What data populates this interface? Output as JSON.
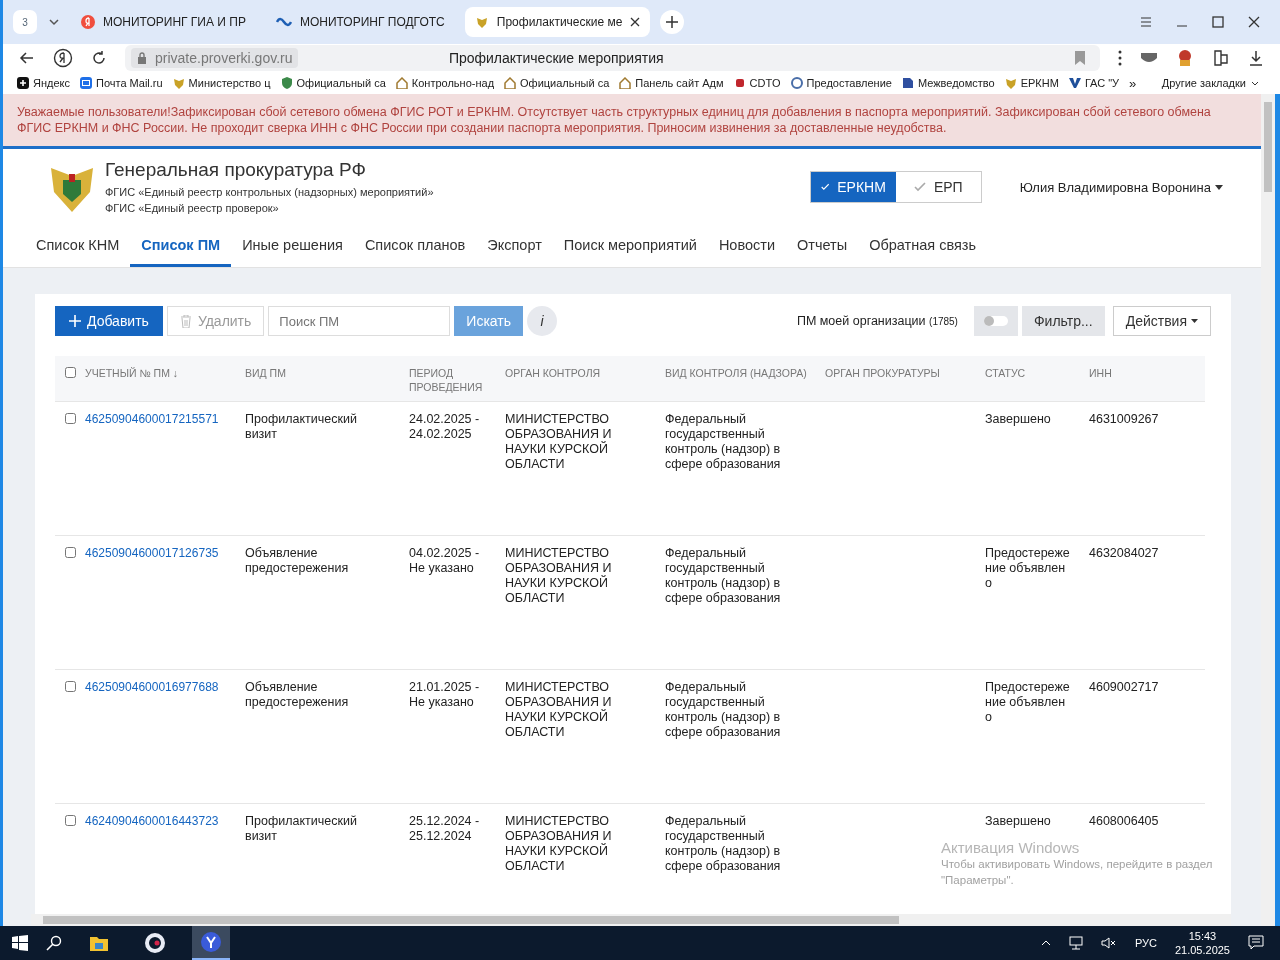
{
  "browser": {
    "tab_count": "3",
    "tabs": [
      {
        "title": "МОНИТОРИНГ ГИА И ПР",
        "selected": false,
        "kind": "yandex"
      },
      {
        "title": "МОНИТОРИНГ ПОДГОТС",
        "selected": false,
        "kind": "wave"
      },
      {
        "title": "Профилактические ме",
        "selected": true,
        "kind": "emblem"
      }
    ],
    "url": "private.proverki.gov.ru",
    "page_title": "Профилактические мероприятия",
    "bookmarks": [
      {
        "label": "Яндекс",
        "kind": "plus"
      },
      {
        "label": "Почта Mail.ru",
        "kind": "mail"
      },
      {
        "label": "Министерство ц",
        "kind": "emblem"
      },
      {
        "label": "Официальный са",
        "kind": "shield"
      },
      {
        "label": "Контрольно-над",
        "kind": "house"
      },
      {
        "label": "Официальный са",
        "kind": "house"
      },
      {
        "label": "Панель сайт Адм",
        "kind": "house"
      },
      {
        "label": "CDTO",
        "kind": "red"
      },
      {
        "label": "Предоставление",
        "kind": "circle"
      },
      {
        "label": "Межведомство",
        "kind": "book"
      },
      {
        "label": "ЕРКНМ",
        "kind": "emblem"
      },
      {
        "label": "ГАС \"У",
        "kind": "v"
      }
    ],
    "more_bookmarks": "»",
    "other_bookmarks": "Другие закладки"
  },
  "banner": "Уважаемые пользователи!Зафиксирован сбой сетевого обмена ФГИС РОТ и ЕРКНМ. Отсутствует часть структурных единиц для добавления в паспорта мероприятий. Зафиксирован сбой сетевого обмена ФГИС ЕРКНМ и ФНС России. Не проходит сверка ИНН с ФНС России при создании паспорта мероприятия. Приносим извинения за доставленные неудобства.",
  "header": {
    "title": "Генеральная прокуратура РФ",
    "subtitles": [
      "ФГИС «Единый реестр контрольных (надзорных) мероприятий»",
      "ФГИС «Единый реестр проверок»"
    ],
    "systems": [
      {
        "label": "ЕРКНМ",
        "selected": true
      },
      {
        "label": "ЕРП",
        "selected": false
      }
    ],
    "user": "Юлия Владимировна Воронина"
  },
  "nav": [
    {
      "label": "Список КНМ",
      "selected": false
    },
    {
      "label": "Список ПМ",
      "selected": true
    },
    {
      "label": "Иные решения",
      "selected": false
    },
    {
      "label": "Список планов",
      "selected": false
    },
    {
      "label": "Экспорт",
      "selected": false
    },
    {
      "label": "Поиск мероприятий",
      "selected": false
    },
    {
      "label": "Новости",
      "selected": false
    },
    {
      "label": "Отчеты",
      "selected": false
    },
    {
      "label": "Обратная связь",
      "selected": false
    }
  ],
  "toolbar": {
    "add": "Добавить",
    "delete": "Удалить",
    "search_placeholder": "Поиск ПМ",
    "search": "Искать",
    "info": "i",
    "my_org": "ПМ моей организации",
    "my_org_count": "(1785)",
    "my_org_on": false,
    "filter": "Фильтр...",
    "actions": "Действия"
  },
  "table": {
    "all_checked": false,
    "columns": [
      "УЧЕТНЫЙ № ПМ ↓",
      "ВИД ПМ",
      "ПЕРИОД ПРОВЕДЕНИЯ",
      "ОРГАН КОНТРОЛЯ",
      "ВИД КОНТРОЛЯ (НАДЗОРА)",
      "ОРГАН ПРОКУРАТУРЫ",
      "СТАТУС",
      "ИНН"
    ],
    "rows": [
      {
        "checked": false,
        "number": "46250904600017215571",
        "type": "Профилактический визит",
        "period": [
          "24.02.2025 -",
          "24.02.2025"
        ],
        "authority": "МИНИСТЕРСТВО ОБРАЗОВАНИЯ И НАУКИ КУРСКОЙ ОБЛАСТИ",
        "control": "Федеральный государственный контроль (надзор) в сфере образования",
        "status": "Завершено",
        "inn": "4631009267"
      },
      {
        "checked": false,
        "number": "46250904600017126735",
        "type": "Объявление предостережения",
        "period": [
          "04.02.2025 -",
          "Не указано"
        ],
        "authority": "МИНИСТЕРСТВО ОБРАЗОВАНИЯ И НАУКИ КУРСКОЙ ОБЛАСТИ",
        "control": "Федеральный государственный контроль (надзор) в сфере образования",
        "status": "Предостережение объявлено",
        "inn": "4632084027"
      },
      {
        "checked": false,
        "number": "46250904600016977688",
        "type": "Объявление предостережения",
        "period": [
          "21.01.2025 -",
          "Не указано"
        ],
        "authority": "МИНИСТЕРСТВО ОБРАЗОВАНИЯ И НАУКИ КУРСКОЙ ОБЛАСТИ",
        "control": "Федеральный государственный контроль (надзор) в сфере образования",
        "status": "Предостережение объявлено",
        "inn": "4609002717"
      },
      {
        "checked": false,
        "number": "46240904600016443723",
        "type": "Профилактический визит",
        "period": [
          "25.12.2024 -",
          "25.12.2024"
        ],
        "authority": "МИНИСТЕРСТВО ОБРАЗОВАНИЯ И НАУКИ КУРСКОЙ ОБЛАСТИ",
        "control": "Федеральный государственный контроль (надзор) в сфере образования",
        "status": "Завершено",
        "inn": "4608006405"
      }
    ]
  },
  "activation": {
    "title": "Активация Windows",
    "text": "Чтобы активировать Windows, перейдите в раздел \"Параметры\"."
  },
  "taskbar": {
    "apps": [
      {
        "kind": "folder",
        "selected": false
      },
      {
        "kind": "ring",
        "selected": false
      },
      {
        "kind": "y",
        "selected": true
      }
    ],
    "language": "РУС",
    "time": "15:43",
    "date": "21.05.2025"
  }
}
